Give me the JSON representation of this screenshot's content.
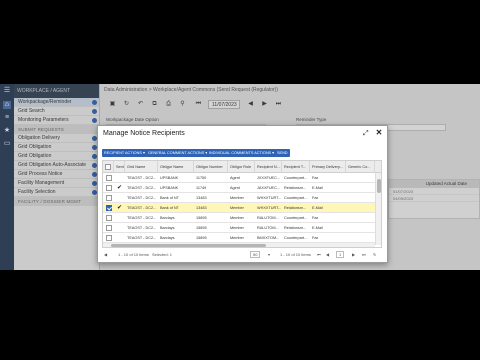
{
  "breadcrumb": "Data Administration  >  Workplace/Agent Commons  (Send Request (Regulator))",
  "rail": {
    "icons": [
      "menu-icon",
      "home-icon",
      "list-icon",
      "star-icon",
      "folder-icon"
    ]
  },
  "sidebar": {
    "header": "WORKPLACE / AGENT",
    "items": [
      {
        "label": "Workpackage/Reminder",
        "selected": true
      },
      {
        "label": "Grid Search",
        "selected": false
      },
      {
        "label": "Monitoring Parameters",
        "selected": false
      }
    ],
    "section1": "SUBMIT REQUESTS",
    "items2": [
      {
        "label": "Obligation Delivery"
      },
      {
        "label": "Grid Obligation"
      },
      {
        "label": "Grid Obligation"
      },
      {
        "label": "Grid Obligation Auto-Associate"
      },
      {
        "label": "Grid Process Notice"
      },
      {
        "label": "Facility Management"
      },
      {
        "label": "Facility Selection"
      }
    ],
    "section2": "FACILITY / DOSSIER MGMT"
  },
  "toolbar": {
    "date": "11/07/2023",
    "nav_prev": "◀",
    "nav_next": "▶",
    "nav_first": "⏮",
    "nav_last": "⏭"
  },
  "form": {
    "left_label": "Workpackage Date Option",
    "right_label": "Reminder Type"
  },
  "right_panel": {
    "header": "Updated Actual Date",
    "rows": [
      "01/07/2023",
      "04/09/2023"
    ]
  },
  "modal": {
    "title": "Manage Notice Recipients",
    "actions": [
      {
        "label": "RECIPIENT ACTIONS ▾"
      },
      {
        "label": "GENERAL COMMENT ACTIONS ▾"
      },
      {
        "label": "INDIVIDUAL COMMENTS ACTIONS ▾"
      },
      {
        "label": "SEND"
      }
    ],
    "columns": [
      "",
      "Sent",
      "Grid Name",
      "Obligor Name",
      "Obligor Number",
      "Obligor Role",
      "Recipient N...",
      "Recipient T...",
      "Primary Delivery...",
      "Generic Co..."
    ],
    "rows": [
      {
        "selected": false,
        "checked": false,
        "sent": "",
        "grid": "TEAOST - DC2...",
        "name": "UPSBANK",
        "num": "11750",
        "role": "Agent",
        "rname": "JXXXFUEC...",
        "rtype": "Counterpart...",
        "delivery": "Fax",
        "generic": ""
      },
      {
        "selected": false,
        "checked": false,
        "sent": "✔",
        "grid": "TEAOST - DC2...",
        "name": "UPSBANK",
        "num": "11749",
        "role": "Agent",
        "rname": "JAXXFUEC...",
        "rtype": "Relationsm...",
        "delivery": "E-Mail",
        "generic": ""
      },
      {
        "selected": false,
        "checked": false,
        "sent": "",
        "grid": "TEAOST - DC2...",
        "name": "Bank of NT",
        "num": "13483",
        "role": "Member",
        "rname": "WHXXTURT...",
        "rtype": "Counterpart...",
        "delivery": "Fax",
        "generic": ""
      },
      {
        "selected": true,
        "checked": true,
        "sent": "✔",
        "grid": "TEAOST - DC2...",
        "name": "Bank of NT",
        "num": "13483",
        "role": "Member",
        "rname": "WHXXTURT...",
        "rtype": "Relationsm...",
        "delivery": "E-Mail",
        "generic": ""
      },
      {
        "selected": false,
        "checked": false,
        "sent": "",
        "grid": "TEAOST - DC2...",
        "name": "Barclays",
        "num": "15895",
        "role": "Member",
        "rname": "RALUTOM...",
        "rtype": "Counterpart...",
        "delivery": "Fax",
        "generic": ""
      },
      {
        "selected": false,
        "checked": false,
        "sent": "",
        "grid": "TEAOST - DC2...",
        "name": "Barclays",
        "num": "15895",
        "role": "Member",
        "rname": "RALUTOM...",
        "rtype": "Relationsm...",
        "delivery": "E-Mail",
        "generic": ""
      },
      {
        "selected": false,
        "checked": false,
        "sent": "",
        "grid": "TEAOST - DC2...",
        "name": "Barclays",
        "num": "15895",
        "role": "Member",
        "rname": "BMXXTOM...",
        "rtype": "Counterpart...",
        "delivery": "Fax",
        "generic": ""
      }
    ],
    "pager": {
      "summary": "1 - 10 of 10 items",
      "selected": "Selected: 1",
      "page_size": "50",
      "range": "1 - 10 of 10 items",
      "page": "1"
    }
  }
}
